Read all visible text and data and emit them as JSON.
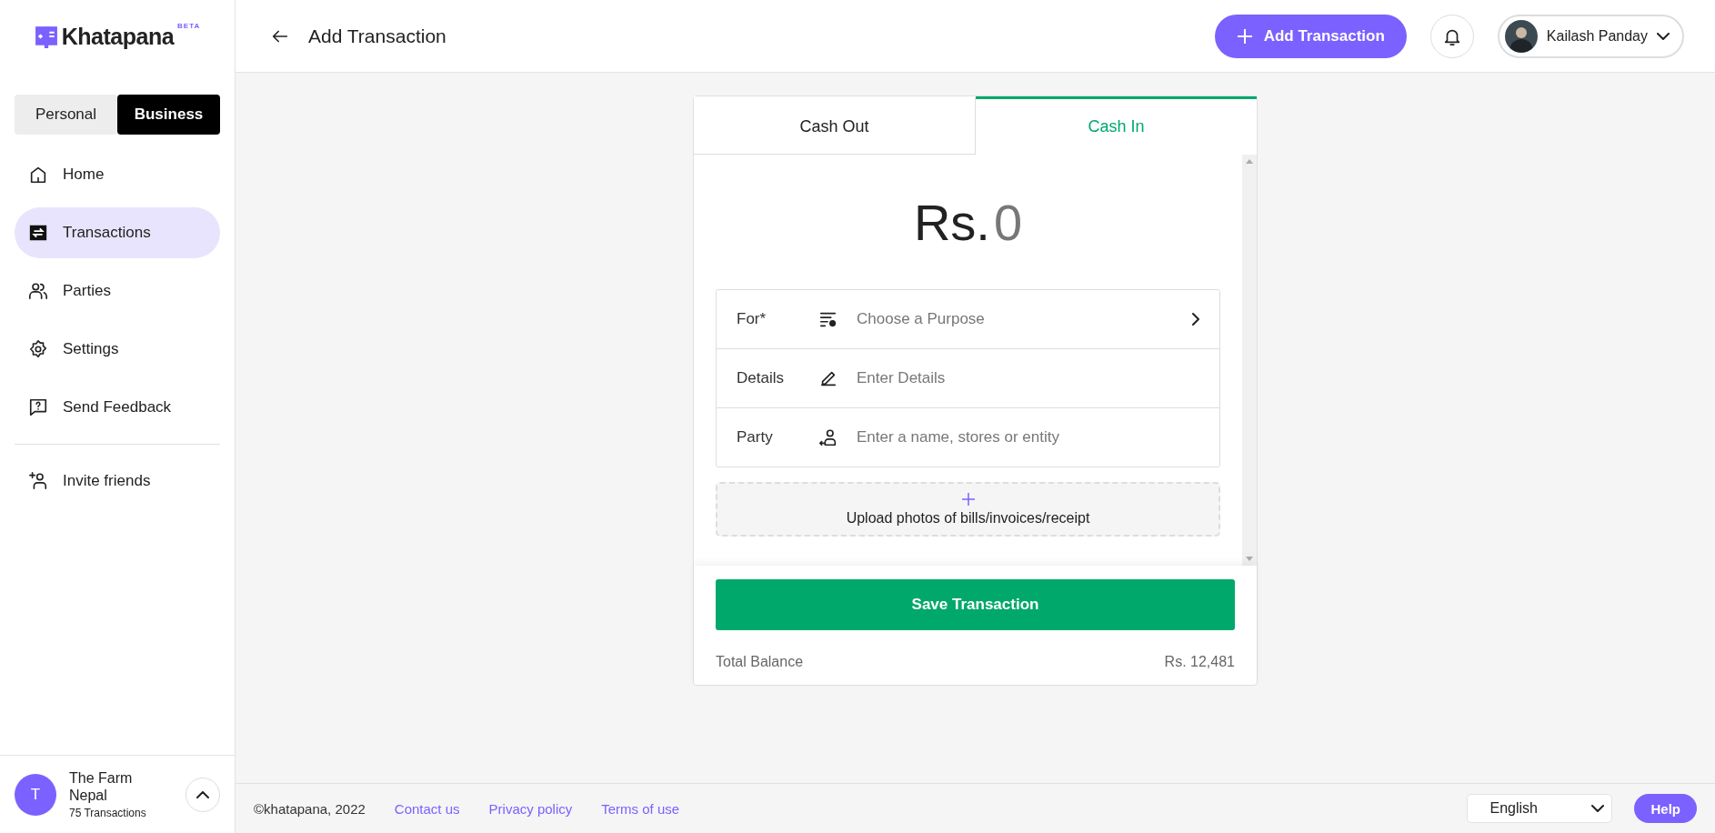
{
  "brand": {
    "name": "Khatapana",
    "badge": "BETA"
  },
  "mode_toggle": [
    {
      "label": "Personal",
      "selected": false
    },
    {
      "label": "Business",
      "selected": true
    }
  ],
  "nav": [
    {
      "kind": "home",
      "label": "Home",
      "selected": false
    },
    {
      "kind": "transactions",
      "label": "Transactions",
      "selected": true
    },
    {
      "kind": "parties",
      "label": "Parties",
      "selected": false
    },
    {
      "kind": "settings",
      "label": "Settings",
      "selected": false
    },
    {
      "kind": "feedback",
      "label": "Send Feedback",
      "selected": false
    }
  ],
  "invite": {
    "label": "Invite friends"
  },
  "account": {
    "initial": "T",
    "name": "The Farm Nepal",
    "count": "75 Transactions"
  },
  "header": {
    "title": "Add Transaction",
    "add_button": "Add Transaction",
    "user": "Kailash Panday"
  },
  "tabs": [
    {
      "label": "Cash Out",
      "selected": false
    },
    {
      "label": "Cash In",
      "selected": true
    }
  ],
  "amount": {
    "currency": "Rs.",
    "value": "0"
  },
  "fields": [
    {
      "kind": "select",
      "label": "For*",
      "placeholder": "Choose a Purpose"
    },
    {
      "kind": "details",
      "label": "Details",
      "placeholder": "Enter Details"
    },
    {
      "kind": "party",
      "label": "Party",
      "placeholder": "Enter a name, stores or entity"
    }
  ],
  "upload": {
    "label": "Upload photos of bills/invoices/receipt"
  },
  "save_button": "Save Transaction",
  "balance": {
    "label": "Total Balance",
    "value": "Rs. 12,481"
  },
  "footer": {
    "copyright": "©khatapana, 2022",
    "links": [
      "Contact us",
      "Privacy policy",
      "Terms of use"
    ],
    "language": "English",
    "help": "Help"
  }
}
